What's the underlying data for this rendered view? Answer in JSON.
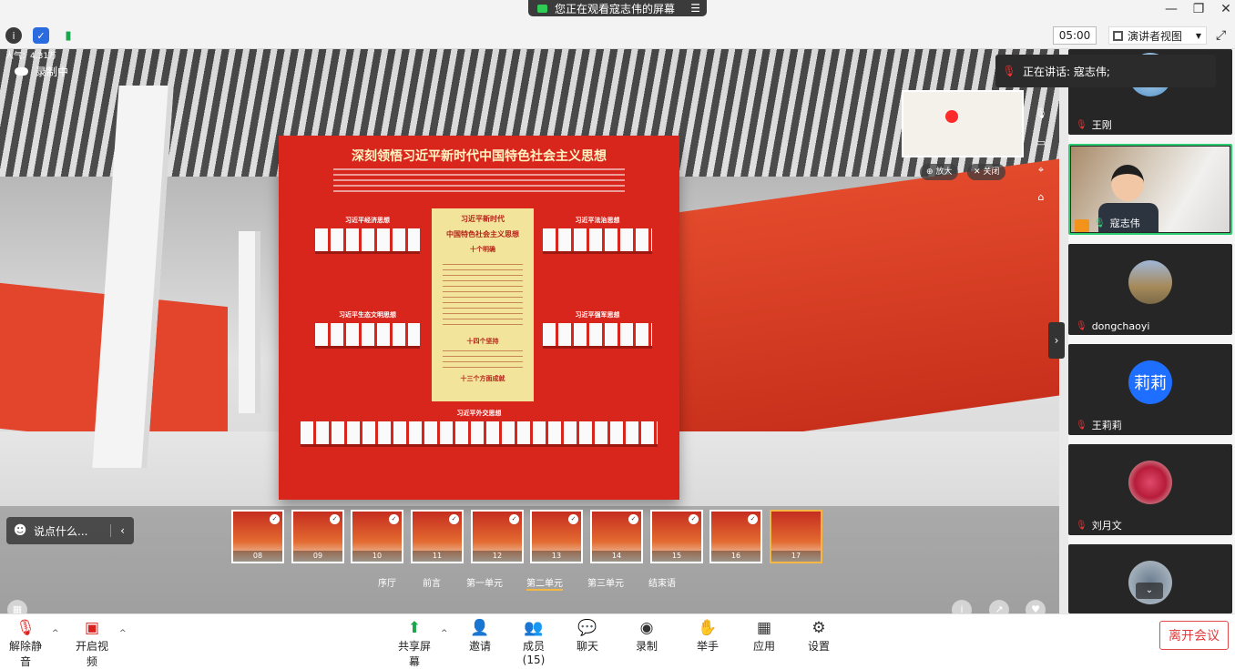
{
  "window": {
    "share_banner": "您正在观看寇志伟的屏幕",
    "menu_icon": "list-icon",
    "minimize": "—",
    "restore": "❐",
    "close": "✕"
  },
  "header": {
    "timer": "05:00",
    "view_label": "演讲者视图",
    "fullscreen_icon": "fullscreen-icon"
  },
  "stage": {
    "popularity": "人气：4.31万",
    "recording": "录制中",
    "board_title": "深刻领悟习近平新时代中国特色社会主义思想",
    "shelves": [
      "习近平经济思想",
      "习近平法治思想",
      "习近平生态文明思想",
      "习近平强军思想",
      "习近平外交思想"
    ],
    "center_title_1": "习近平新时代",
    "center_title_2": "中国特色社会主义思想",
    "center_sub_1": "十个明确",
    "center_sub_2": "十四个坚持",
    "center_sub_3": "十三个方面成就",
    "zoom_in": "放大",
    "close_map": "关闭",
    "chat_placeholder": "说点什么...",
    "thumbs": [
      "08",
      "09",
      "10",
      "11",
      "12",
      "13",
      "14",
      "15",
      "16",
      "17"
    ],
    "units": [
      "序厅",
      "前言",
      "第一单元",
      "第二单元",
      "第三单元",
      "结束语"
    ],
    "active_unit": "第二单元"
  },
  "gallery": {
    "speaking": "正在讲话: 寇志伟;",
    "participants": [
      {
        "name": "王刚"
      },
      {
        "name": "寇志伟"
      },
      {
        "name": "dongchaoyi"
      },
      {
        "name": "王莉莉",
        "avatar_text": "莉莉"
      },
      {
        "name": "刘月文"
      },
      {
        "name": ""
      }
    ]
  },
  "toolbar": {
    "unmute": "解除静音",
    "start_video": "开启视频",
    "share_screen": "共享屏幕",
    "invite": "邀请",
    "members": "成员(15)",
    "chat": "聊天",
    "record": "录制",
    "raise_hand": "举手",
    "apps": "应用",
    "settings": "设置",
    "leave": "离开会议"
  },
  "colors": {
    "accent_green": "#2ecc71",
    "leave_red": "#e13b3b",
    "board_red": "#d8261d"
  }
}
